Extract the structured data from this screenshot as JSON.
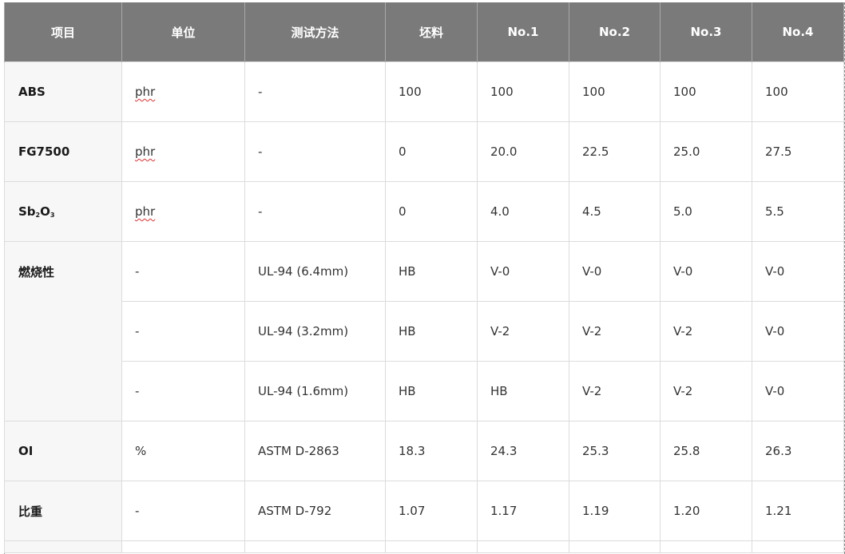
{
  "headers": [
    "项目",
    "单位",
    "测试方法",
    "坯料",
    "No.1",
    "No.2",
    "No.3",
    "No.4"
  ],
  "rows": [
    {
      "item": "ABS",
      "unit": "phr",
      "method": "-",
      "values": [
        "100",
        "100",
        "100",
        "100",
        "100"
      ]
    },
    {
      "item": "FG7500",
      "unit": "phr",
      "method": "-",
      "values": [
        "0",
        "20.0",
        "22.5",
        "25.0",
        "27.5"
      ]
    },
    {
      "item_main": "Sb",
      "item_sub1": "2",
      "item_mid": "O",
      "item_sub2": "3",
      "unit": "phr",
      "method": "-",
      "values": [
        "0",
        "4.0",
        "4.5",
        "5.0",
        "5.5"
      ]
    },
    {
      "item": "燃烧性",
      "unit": "-",
      "method": "UL-94 (6.4mm)",
      "values": [
        "HB",
        "V-0",
        "V-0",
        "V-0",
        "V-0"
      ]
    },
    {
      "unit": "-",
      "method": "UL-94 (3.2mm)",
      "values": [
        "HB",
        "V-2",
        "V-2",
        "V-2",
        "V-0"
      ]
    },
    {
      "unit": "-",
      "method": "UL-94 (1.6mm)",
      "values": [
        "HB",
        "HB",
        "V-2",
        "V-2",
        "V-0"
      ]
    },
    {
      "item": "OI",
      "unit": "%",
      "method": "ASTM D-2863",
      "values": [
        "18.3",
        "24.3",
        "25.3",
        "25.8",
        "26.3"
      ]
    },
    {
      "item": "比重",
      "unit": "-",
      "method": "ASTM D-792",
      "values": [
        "1.07",
        "1.17",
        "1.19",
        "1.20",
        "1.21"
      ]
    }
  ]
}
